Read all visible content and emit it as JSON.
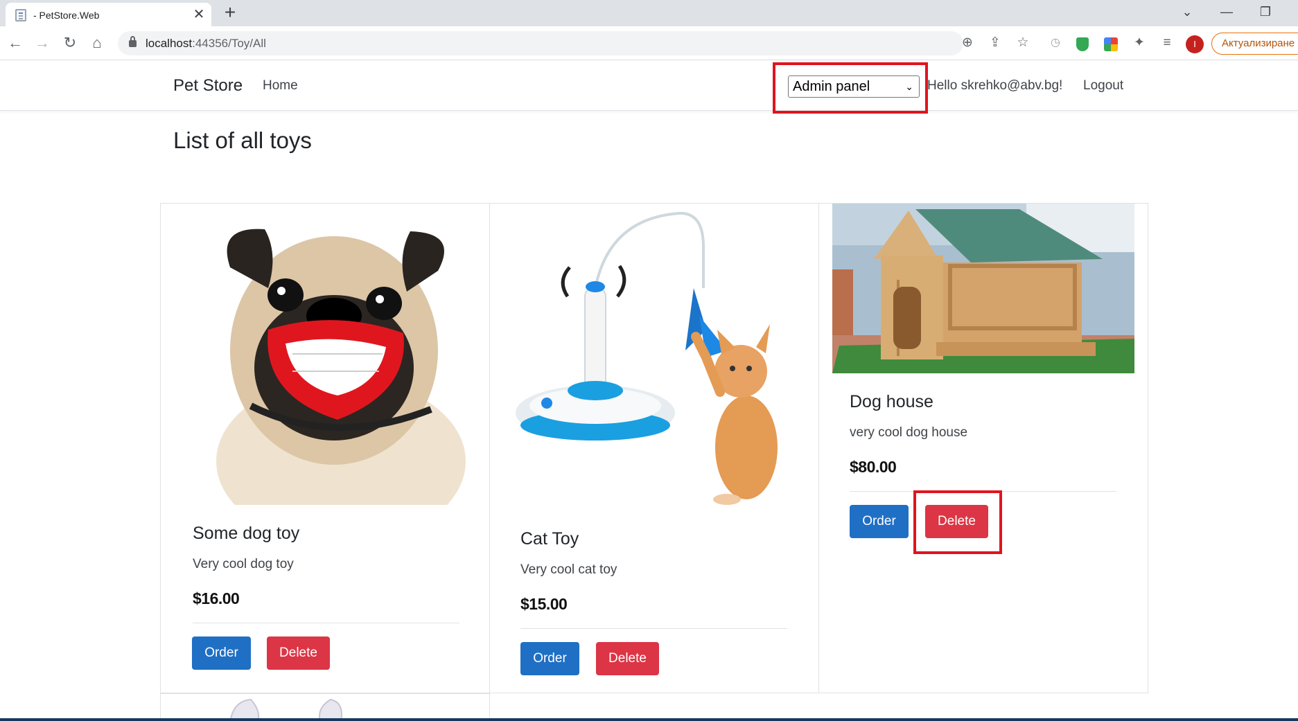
{
  "browser": {
    "tab_title": "- PetStore.Web",
    "tab_close": "✕",
    "new_tab": "+",
    "url_host": "localhost",
    "url_path": ":44356/Toy/All",
    "profile_initial": "I",
    "update_label": "Актуализиране",
    "icons": [
      "back-icon",
      "forward-icon",
      "reload-icon",
      "home-icon",
      "lock-icon",
      "zoom-icon",
      "share-icon",
      "star-icon",
      "history-icon",
      "shield-extension-icon",
      "palette-extension-icon",
      "puzzle-icon",
      "reading-list-icon"
    ]
  },
  "navbar": {
    "brand": "Pet Store",
    "home": "Home",
    "admin_select_value": "Admin panel",
    "hello": "Hello skrehko@abv.bg!",
    "logout": "Logout"
  },
  "page": {
    "title": "List of all toys"
  },
  "cards": [
    {
      "title": "Some dog toy",
      "description": "Very cool dog toy",
      "price": "$16.00",
      "order_label": "Order",
      "delete_label": "Delete"
    },
    {
      "title": "Cat Toy",
      "description": "Very cool cat toy",
      "price": "$15.00",
      "order_label": "Order",
      "delete_label": "Delete"
    },
    {
      "title": "Dog house",
      "description": "very cool dog house",
      "price": "$80.00",
      "order_label": "Order",
      "delete_label": "Delete"
    }
  ],
  "colors": {
    "order_button": "#1f6fc5",
    "delete_button": "#dc3545",
    "highlight_box": "#e0141e"
  }
}
